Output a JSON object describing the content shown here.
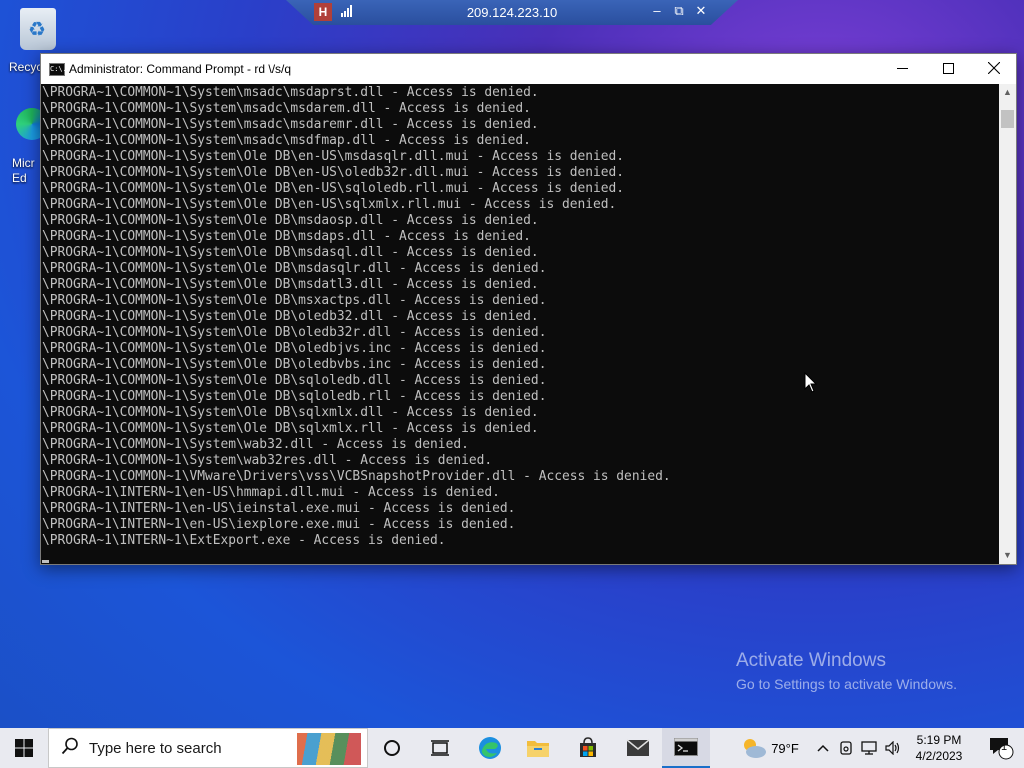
{
  "desktop": {
    "recycle_bin_label": "Recyc",
    "edge_label_line1": "Micr",
    "edge_label_line2": "Ed"
  },
  "rdp": {
    "host": "209.124.223.10",
    "pin_glyph": "H"
  },
  "window": {
    "title": "Administrator: Command Prompt - rd \\/s/q",
    "icon_text": "C:\\."
  },
  "console": {
    "lines": [
      "\\PROGRA~1\\COMMON~1\\System\\msadc\\msdaprst.dll - Access is denied.",
      "\\PROGRA~1\\COMMON~1\\System\\msadc\\msdarem.dll - Access is denied.",
      "\\PROGRA~1\\COMMON~1\\System\\msadc\\msdaremr.dll - Access is denied.",
      "\\PROGRA~1\\COMMON~1\\System\\msadc\\msdfmap.dll - Access is denied.",
      "\\PROGRA~1\\COMMON~1\\System\\Ole DB\\en-US\\msdasqlr.dll.mui - Access is denied.",
      "\\PROGRA~1\\COMMON~1\\System\\Ole DB\\en-US\\oledb32r.dll.mui - Access is denied.",
      "\\PROGRA~1\\COMMON~1\\System\\Ole DB\\en-US\\sqloledb.rll.mui - Access is denied.",
      "\\PROGRA~1\\COMMON~1\\System\\Ole DB\\en-US\\sqlxmlx.rll.mui - Access is denied.",
      "\\PROGRA~1\\COMMON~1\\System\\Ole DB\\msdaosp.dll - Access is denied.",
      "\\PROGRA~1\\COMMON~1\\System\\Ole DB\\msdaps.dll - Access is denied.",
      "\\PROGRA~1\\COMMON~1\\System\\Ole DB\\msdasql.dll - Access is denied.",
      "\\PROGRA~1\\COMMON~1\\System\\Ole DB\\msdasqlr.dll - Access is denied.",
      "\\PROGRA~1\\COMMON~1\\System\\Ole DB\\msdatl3.dll - Access is denied.",
      "\\PROGRA~1\\COMMON~1\\System\\Ole DB\\msxactps.dll - Access is denied.",
      "\\PROGRA~1\\COMMON~1\\System\\Ole DB\\oledb32.dll - Access is denied.",
      "\\PROGRA~1\\COMMON~1\\System\\Ole DB\\oledb32r.dll - Access is denied.",
      "\\PROGRA~1\\COMMON~1\\System\\Ole DB\\oledbjvs.inc - Access is denied.",
      "\\PROGRA~1\\COMMON~1\\System\\Ole DB\\oledbvbs.inc - Access is denied.",
      "\\PROGRA~1\\COMMON~1\\System\\Ole DB\\sqloledb.dll - Access is denied.",
      "\\PROGRA~1\\COMMON~1\\System\\Ole DB\\sqloledb.rll - Access is denied.",
      "\\PROGRA~1\\COMMON~1\\System\\Ole DB\\sqlxmlx.dll - Access is denied.",
      "\\PROGRA~1\\COMMON~1\\System\\Ole DB\\sqlxmlx.rll - Access is denied.",
      "\\PROGRA~1\\COMMON~1\\System\\wab32.dll - Access is denied.",
      "\\PROGRA~1\\COMMON~1\\System\\wab32res.dll - Access is denied.",
      "\\PROGRA~1\\COMMON~1\\VMware\\Drivers\\vss\\VCBSnapshotProvider.dll - Access is denied.",
      "\\PROGRA~1\\INTERN~1\\en-US\\hmmapi.dll.mui - Access is denied.",
      "\\PROGRA~1\\INTERN~1\\en-US\\ieinstal.exe.mui - Access is denied.",
      "\\PROGRA~1\\INTERN~1\\en-US\\iexplore.exe.mui - Access is denied.",
      "\\PROGRA~1\\INTERN~1\\ExtExport.exe - Access is denied."
    ]
  },
  "watermark": {
    "line1": "Activate Windows",
    "line2": "Go to Settings to activate Windows."
  },
  "taskbar": {
    "search_placeholder": "Type here to search",
    "weather_temp": "79°F",
    "time": "5:19 PM",
    "date": "4/2/2023",
    "notification_count": "1"
  },
  "colors": {
    "console_bg": "#0c0c0c",
    "console_text": "#c0c0c0",
    "taskbar_bg": "#e9eaf0",
    "accent": "#1a6fc9"
  }
}
